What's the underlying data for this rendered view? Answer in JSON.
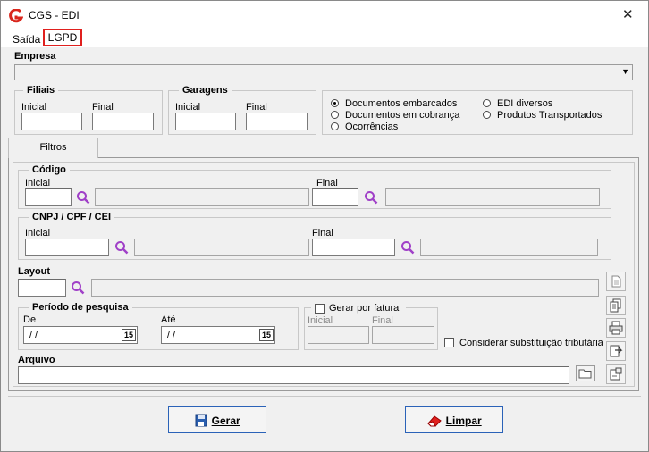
{
  "window": {
    "title": "CGS - EDI",
    "close_glyph": "✕"
  },
  "menu": {
    "saida": "Saída",
    "lgpd": "LGPD"
  },
  "empresa": {
    "label": "Empresa",
    "value": ""
  },
  "filiais": {
    "title": "Filiais",
    "inicial": "Inicial",
    "final": "Final"
  },
  "garagens": {
    "title": "Garagens",
    "inicial": "Inicial",
    "final": "Final"
  },
  "doc_type": {
    "options": [
      "Documentos embarcados",
      "Documentos em cobrança",
      "Ocorrências",
      "EDI diversos",
      "Produtos Transportados"
    ],
    "selected": "Documentos embarcados"
  },
  "tab": {
    "label": "Filtros"
  },
  "codigo": {
    "title": "Código",
    "inicial": "Inicial",
    "final": "Final"
  },
  "cnpj": {
    "title": "CNPJ / CPF / CEI",
    "inicial": "Inicial",
    "final": "Final"
  },
  "layout": {
    "label": "Layout"
  },
  "periodo": {
    "title": "Período de pesquisa",
    "de": "De",
    "ate": "Até",
    "de_value": "/ /",
    "ate_value": "/ /",
    "cal_glyph": "15"
  },
  "fatura": {
    "label": "Gerar por fatura",
    "inicial": "Inicial",
    "final": "Final",
    "checked": false
  },
  "substituicao": {
    "label": "Considerar substituição tributária",
    "checked": false
  },
  "arquivo": {
    "label": "Arquivo",
    "value": ""
  },
  "buttons": {
    "gerar": "Gerar",
    "limpar": "Limpar"
  },
  "colors": {
    "accent_red": "#e0201e",
    "button_border": "#2a62b8",
    "search_icon": "#a040c8"
  }
}
